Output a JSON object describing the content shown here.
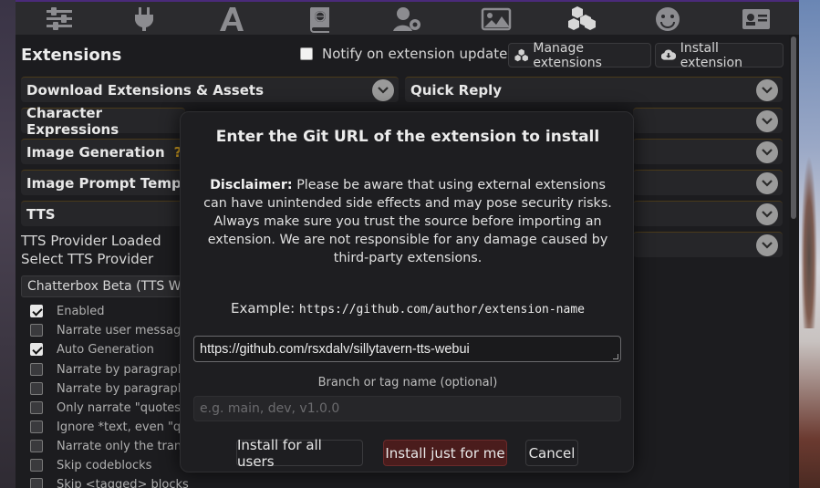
{
  "nav_icons": [
    "sliders-icon",
    "plug-icon",
    "font-icon",
    "book-globe-icon",
    "user-gear-icon",
    "image-icon",
    "cubes-icon",
    "smile-icon",
    "id-card-icon"
  ],
  "extensions": {
    "title": "Extensions",
    "notify_label": "Notify on extension updates",
    "manage_label": "Manage extensions",
    "install_label": "Install extension"
  },
  "drawers_left": [
    "Download Extensions & Assets",
    "Character Expressions",
    "Image Generation",
    "Image Prompt Templates",
    "TTS"
  ],
  "image_gen_help": "?",
  "drawers_right": [
    "Quick Reply"
  ],
  "tts": {
    "provider_loaded": "TTS Provider Loaded",
    "select_provider": "Select TTS Provider",
    "selected_provider": "Chatterbox Beta (TTS WebUI)",
    "options": [
      {
        "label": "Enabled",
        "checked": true
      },
      {
        "label": "Narrate user messages",
        "checked": false
      },
      {
        "label": "Auto Generation",
        "checked": true
      },
      {
        "label": "Narrate by paragraphs (when streaming)",
        "checked": false
      },
      {
        "label": "Narrate by paragraphs (when not streaming)",
        "checked": false
      },
      {
        "label": "Only narrate \"quotes\"",
        "checked": false
      },
      {
        "label": "Ignore *text, even \"quotes\", inside asterisks*",
        "checked": false
      },
      {
        "label": "Narrate only the translated text",
        "checked": false
      },
      {
        "label": "Skip codeblocks",
        "checked": false
      },
      {
        "label": "Skip <tagged> blocks",
        "checked": false
      }
    ]
  },
  "modal": {
    "title": "Enter the Git URL of the extension to install",
    "disclaimer_label": "Disclaimer:",
    "disclaimer_text": "Please be aware that using external extensions can have unintended side effects and may pose security risks. Always make sure you trust the source before importing an extension. We are not responsible for any damage caused by third-party extensions.",
    "example_label": "Example:",
    "example_url": "https://github.com/author/extension-name",
    "url_value": "https://github.com/rsxdalv/sillytavern-tts-webui",
    "branch_label": "Branch or tag name (optional)",
    "branch_placeholder": "e.g. main, dev, v1.0.0",
    "btn_all": "Install for all users",
    "btn_me": "Install just for me",
    "btn_cancel": "Cancel"
  }
}
